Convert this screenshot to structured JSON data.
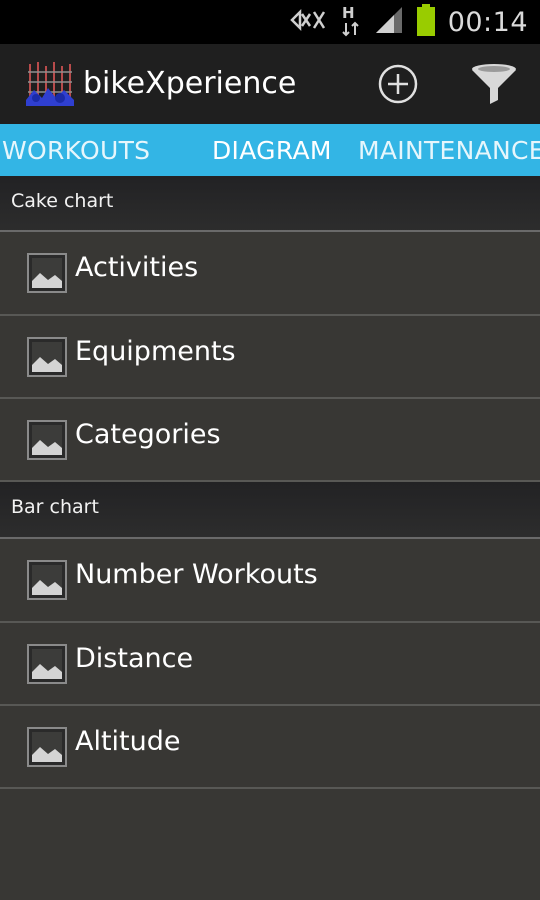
{
  "status_bar": {
    "time": "00:14",
    "icons": [
      "no-signal-muted-icon",
      "h-network-icon",
      "cell-signal-icon",
      "battery-icon"
    ],
    "battery_color": "#99cc00"
  },
  "action_bar": {
    "title": "bikeXperience",
    "actions": [
      "add-icon",
      "filter-icon"
    ]
  },
  "tabs": [
    {
      "label": "WORKOUTS",
      "selected": false
    },
    {
      "label": "DIAGRAM",
      "selected": true
    },
    {
      "label": "MAINTENANCE",
      "selected": false
    }
  ],
  "sections": [
    {
      "title": "Cake chart",
      "items": [
        {
          "label": "Activities",
          "icon": "image-icon"
        },
        {
          "label": "Equipments",
          "icon": "image-icon"
        },
        {
          "label": "Categories",
          "icon": "image-icon"
        }
      ]
    },
    {
      "title": "Bar chart",
      "items": [
        {
          "label": "Number Workouts",
          "icon": "image-icon"
        },
        {
          "label": "Distance",
          "icon": "image-icon"
        },
        {
          "label": "Altitude",
          "icon": "image-icon"
        }
      ]
    }
  ],
  "colors": {
    "accent": "#33b5e5",
    "background": "#383734",
    "action_bar": "#1f1f1f",
    "status_bar": "#000000"
  }
}
